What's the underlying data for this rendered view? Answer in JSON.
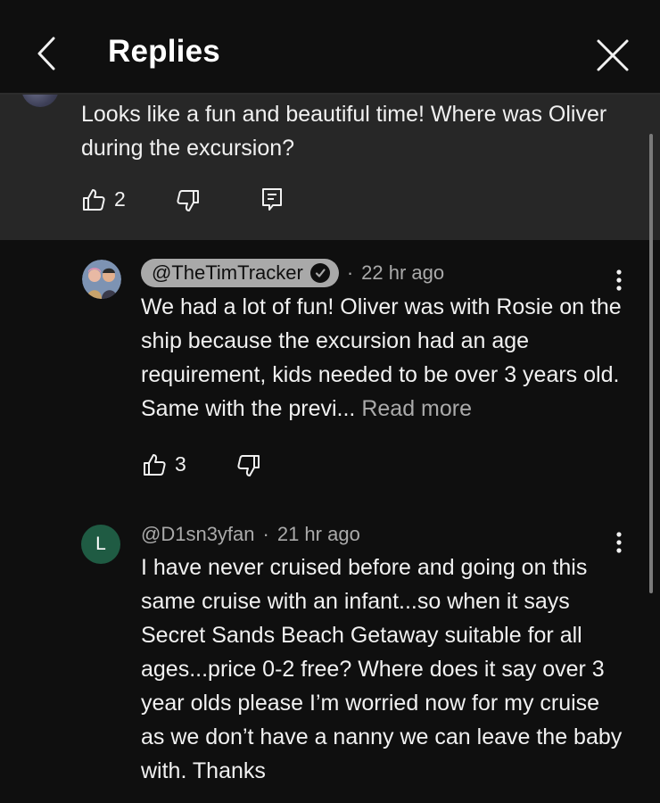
{
  "header": {
    "title": "Replies"
  },
  "parent_comment": {
    "text": "Looks like a fun and beautiful time! Where was Oliver during the excursion?",
    "like_count": "2"
  },
  "replies": [
    {
      "author": "@TheTimTracker",
      "verified": true,
      "separator": "·",
      "time": "22 hr ago",
      "text": "We had a lot of fun! Oliver was with Rosie on the ship because the excursion had an age requirement, kids needed to be over 3 years old. Same with the previ...",
      "read_more": "Read more",
      "like_count": "3"
    },
    {
      "author": "@D1sn3yfan",
      "avatar_letter": "L",
      "separator": "·",
      "time": "21 hr ago",
      "text": "I have never cruised before and going on this same cruise with an infant...so when it says Secret Sands Beach Getaway suitable for all ages...price 0-2 free? Where does it say over 3 year olds please I’m worried now for my cruise as we don’t have a nanny we can leave the baby with. Thanks"
    }
  ],
  "colors": {
    "background": "#0f0f0f",
    "highlighted_background": "#272727",
    "author_pill": "#a9a9a9",
    "secondary_text": "#aaaaaa",
    "avatar_green": "#1f5b43"
  },
  "icons": [
    "back-chevron-icon",
    "close-icon",
    "like-icon",
    "dislike-icon",
    "reply-icon",
    "verified-check-icon",
    "more-options-icon"
  ]
}
